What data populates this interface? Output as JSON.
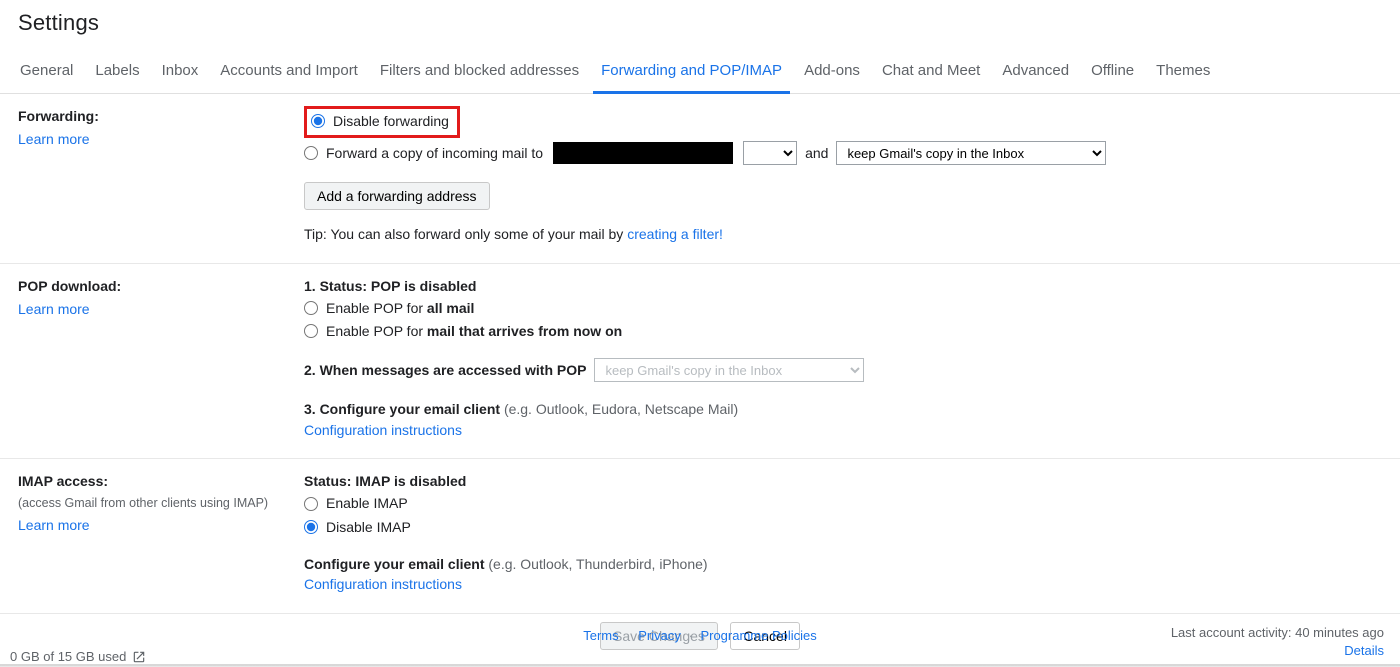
{
  "header": {
    "title": "Settings"
  },
  "tabs": [
    {
      "label": "General"
    },
    {
      "label": "Labels"
    },
    {
      "label": "Inbox"
    },
    {
      "label": "Accounts and Import"
    },
    {
      "label": "Filters and blocked addresses"
    },
    {
      "label": "Forwarding and POP/IMAP",
      "active": true
    },
    {
      "label": "Add-ons"
    },
    {
      "label": "Chat and Meet"
    },
    {
      "label": "Advanced"
    },
    {
      "label": "Offline"
    },
    {
      "label": "Themes"
    }
  ],
  "forwarding": {
    "label": "Forwarding:",
    "learn_more": "Learn more",
    "disable_label": "Disable forwarding",
    "forward_copy_prefix": "Forward a copy of incoming mail to",
    "and_text": "and",
    "keep_option": "keep Gmail's copy in the Inbox",
    "add_address_button": "Add a forwarding address",
    "tip_prefix": "Tip: You can also forward only some of your mail by ",
    "tip_link": "creating a filter!"
  },
  "pop": {
    "label": "POP download:",
    "learn_more": "Learn more",
    "status_prefix": "1. Status: ",
    "status_value": "POP is disabled",
    "enable_all_prefix": "Enable POP for ",
    "enable_all_bold": "all mail",
    "enable_now_prefix": "Enable POP for ",
    "enable_now_bold": "mail that arrives from now on",
    "when_accessed": "2. When messages are accessed with POP",
    "when_option": "keep Gmail's copy in the Inbox",
    "configure_prefix": "3. Configure your email client ",
    "configure_note": "(e.g. Outlook, Eudora, Netscape Mail)",
    "config_link": "Configuration instructions"
  },
  "imap": {
    "label": "IMAP access:",
    "sub": "(access Gmail from other clients using IMAP)",
    "learn_more": "Learn more",
    "status_prefix": "Status: ",
    "status_value": "IMAP is disabled",
    "enable_label": "Enable IMAP",
    "disable_label": "Disable IMAP",
    "configure_prefix": "Configure your email client ",
    "configure_note": "(e.g. Outlook, Thunderbird, iPhone)",
    "config_link": "Configuration instructions"
  },
  "actions": {
    "save": "Save Changes",
    "cancel": "Cancel"
  },
  "footer": {
    "terms": "Terms",
    "privacy": "Privacy",
    "policies": "Programme Policies",
    "activity": "Last account activity: 40 minutes ago",
    "details": "Details",
    "storage": "0 GB of 15 GB used"
  }
}
